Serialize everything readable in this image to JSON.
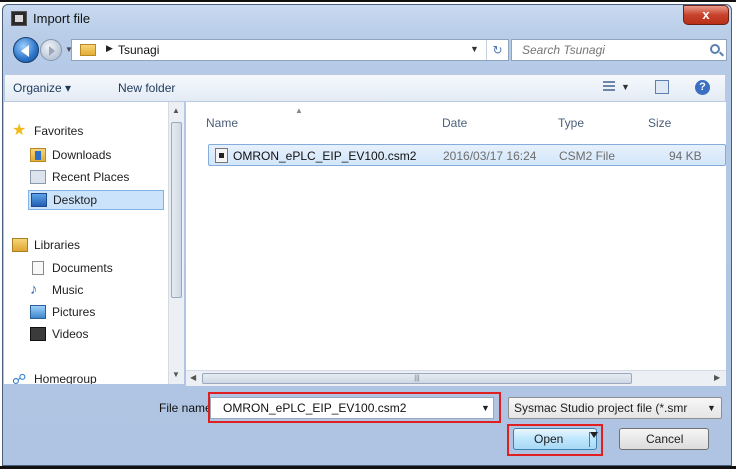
{
  "window": {
    "title": "Import file",
    "close_label": "x"
  },
  "navbar": {
    "crumb": "Tsunagi",
    "search_placeholder": "Search Tsunagi",
    "refresh_icon": "refresh-icon"
  },
  "toolbar": {
    "organize_label": "Organize",
    "new_folder_label": "New folder"
  },
  "nav_pane": {
    "items": [
      {
        "label": "Favorites",
        "icon": "star-icon"
      },
      {
        "label": "Downloads",
        "icon": "downloads-folder-icon"
      },
      {
        "label": "Recent Places",
        "icon": "recent-places-icon"
      },
      {
        "label": "Desktop",
        "icon": "desktop-icon",
        "selected": true
      },
      {
        "label": "Libraries",
        "icon": "libraries-icon"
      },
      {
        "label": "Documents",
        "icon": "documents-icon"
      },
      {
        "label": "Music",
        "icon": "music-icon"
      },
      {
        "label": "Pictures",
        "icon": "pictures-icon"
      },
      {
        "label": "Videos",
        "icon": "videos-icon"
      },
      {
        "label": "Homegroup",
        "icon": "homegroup-icon"
      }
    ]
  },
  "file_list": {
    "columns": [
      "Name",
      "Date",
      "Type",
      "Size"
    ],
    "rows": [
      {
        "name": "OMRON_ePLC_EIP_EV100.csm2",
        "date": "2016/03/17 16:24",
        "type": "CSM2 File",
        "size": "94 KB"
      }
    ]
  },
  "footer": {
    "file_name_label": "File name:",
    "file_name_value": "OMRON_ePLC_EIP_EV100.csm2",
    "file_type_value": "Sysmac Studio project file (*.smr",
    "open_label": "Open",
    "cancel_label": "Cancel"
  },
  "colors": {
    "highlight": "#e02020",
    "selection": "#cce4fb",
    "accent": "#3c7fb1"
  }
}
